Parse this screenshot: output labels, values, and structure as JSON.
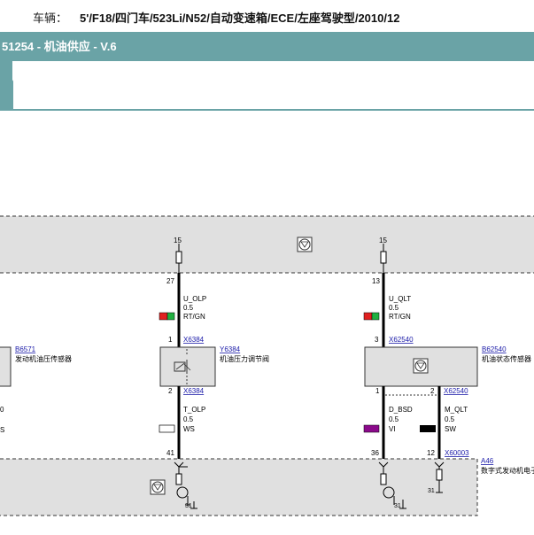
{
  "header": {
    "vehicle_label": "车辆：",
    "vehicle_value": "5'/F18/四门车/523Li/N52/自动变速箱/ECE/左座驾驶型/2010/12",
    "title": "51254 - 机油供应 - V.6"
  },
  "diagram": {
    "pins": {
      "top_left": "15",
      "top_right": "15",
      "c1_top": "27",
      "c2_top": "13",
      "c1_mid": "1",
      "c2_mid": "3",
      "c1_bot": "2",
      "c3_bot": "1",
      "c4_bot": "2",
      "b1": "41",
      "b2": "36",
      "b3": "12",
      "gnd1": "31",
      "gnd2": "31",
      "gnd3": "31"
    },
    "wires": {
      "w1": {
        "signal": "U_OLP",
        "size": "0.5",
        "color": "RT/GN"
      },
      "w2": {
        "signal": "U_QLT",
        "size": "0.5",
        "color": "RT/GN"
      },
      "w3": {
        "signal": "T_OLP",
        "size": "0.5",
        "color": "WS"
      },
      "w4": {
        "signal": "D_BSD",
        "size": "0.5",
        "color": "VI"
      },
      "w5": {
        "signal": "M_QLT",
        "size": "0.5",
        "color": "SW"
      }
    },
    "connectors": {
      "c1": "X6384",
      "c2": "X62540",
      "c3": "X6384",
      "c4": "X62540",
      "c5": "X60003"
    },
    "components": {
      "b6571_id": "B6571",
      "b6571_name": "发动机油压传感器",
      "y6384_id": "Y6384",
      "y6384_name": "机油压力调节阀",
      "b62540_id": "B62540",
      "b62540_name": "机油状态传感器",
      "a46_id": "A46",
      "a46_name": "数字式发动机电子"
    },
    "left_partial": {
      "zero": "0",
      "s": "S"
    },
    "colors": {
      "accent": "#6aa3a6",
      "panel": "#e0e0e0",
      "rt": "#e02020",
      "gn": "#20b040",
      "vi": "#8b0a8b",
      "sw": "#000000",
      "ws": "#ffffff",
      "link": "#1a1aa8"
    },
    "icons": [
      "ground-icon",
      "electronic-module-icon",
      "valve-icon"
    ]
  }
}
